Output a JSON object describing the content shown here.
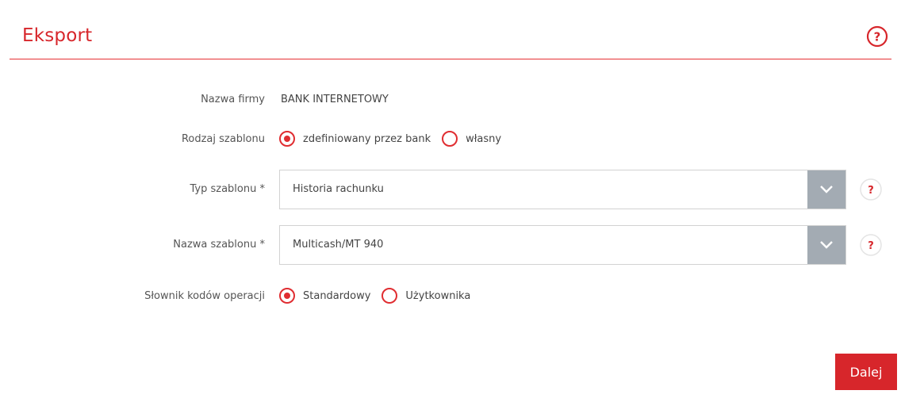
{
  "header": {
    "title": "Eksport",
    "help_icon": "question-circle-icon"
  },
  "form": {
    "company": {
      "label": "Nazwa firmy",
      "value": "BANK INTERNETOWY"
    },
    "template_kind": {
      "label": "Rodzaj szablonu",
      "options": [
        {
          "label": "zdefiniowany przez bank",
          "checked": true
        },
        {
          "label": "własny",
          "checked": false
        }
      ]
    },
    "template_type": {
      "label": "Typ szablonu *",
      "value": "Historia rachunku"
    },
    "template_name": {
      "label": "Nazwa szablonu *",
      "value": "Multicash/MT 940"
    },
    "dictionary": {
      "label": "Słownik kodów operacji",
      "options": [
        {
          "label": "Standardowy",
          "checked": true
        },
        {
          "label": "Użytkownika",
          "checked": false
        }
      ]
    },
    "help_glyph": "?"
  },
  "actions": {
    "next_label": "Dalej"
  },
  "colors": {
    "accent": "#d7262b",
    "dropdown_arrow_bg": "#a3abb3",
    "border": "#d2d2d2"
  }
}
